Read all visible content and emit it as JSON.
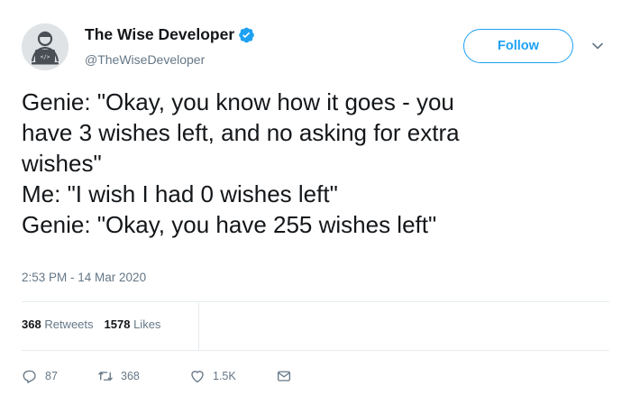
{
  "account": {
    "display_name": "The Wise Developer",
    "handle": "@TheWiseDeveloper",
    "verified": true
  },
  "follow_button": {
    "label": "Follow"
  },
  "tweet": {
    "text": "Genie: \"Okay, you know how it goes - you\nhave 3 wishes left, and no asking for extra\nwishes\"\nMe: \"I wish I had 0 wishes left\"\nGenie: \"Okay, you have 255 wishes left\"",
    "timestamp": "2:53 PM - 14 Mar 2020"
  },
  "stats": {
    "retweets_count": "368",
    "retweets_label": "Retweets",
    "likes_count": "1578",
    "likes_label": "Likes"
  },
  "actions": {
    "reply_count": "87",
    "retweet_count": "368",
    "like_count": "1.5K"
  },
  "colors": {
    "accent": "#1da1f2",
    "muted": "#657786",
    "divider": "#e6ecf0"
  },
  "icons": {
    "avatar": "laptop-person-avatar",
    "verified": "verified-badge-icon",
    "chevron": "chevron-down-icon",
    "reply": "reply-icon",
    "retweet": "retweet-icon",
    "like": "heart-icon",
    "dm": "envelope-icon"
  }
}
